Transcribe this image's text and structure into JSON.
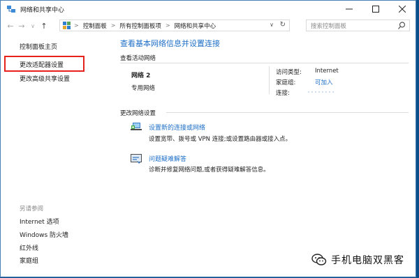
{
  "window": {
    "title": "网络和共享中心",
    "controls": [
      "minimize",
      "maximize",
      "close"
    ]
  },
  "nav": {
    "back_icon": "back-arrow-icon",
    "forward_icon": "forward-arrow-icon",
    "recent_icon": "chevron-down-icon",
    "up_icon": "up-arrow-icon"
  },
  "address": {
    "crumbs": [
      "控制面板",
      "所有控制面板项",
      "网络和共享中心"
    ],
    "separator": ">",
    "dropdown": "∨",
    "refresh": "↻"
  },
  "search": {
    "placeholder": "搜索控制面板"
  },
  "sidebar": {
    "items": [
      {
        "label": "控制面板主页"
      },
      {
        "label": "更改适配器设置",
        "highlighted": true
      },
      {
        "label": "更改高级共享设置"
      }
    ],
    "see_also_label": "另请参阅",
    "see_also_items": [
      {
        "label": "Internet 选项"
      },
      {
        "label": "Windows 防火墙"
      },
      {
        "label": "红外线"
      },
      {
        "label": "家庭组"
      }
    ]
  },
  "main": {
    "heading": "查看基本网络信息并设置连接",
    "active_networks_label": "查看活动网络",
    "network": {
      "name": "网络  2",
      "type": "专用网络",
      "access_type_label": "访问类型:",
      "access_type_value": "Internet",
      "homegroup_label": "家庭组:",
      "homegroup_value": "可加入",
      "connections_label": "连接:"
    },
    "change_settings_label": "更改网络设置",
    "tasks": [
      {
        "title": "设置新的连接或网络",
        "desc": "设置宽带、拨号或 VPN 连接;或设置路由器或接入点。",
        "icon": "new-connection-icon"
      },
      {
        "title": "问题疑难解答",
        "desc": "诊断并修复网络问题,或者获得疑难解答信息。",
        "icon": "troubleshoot-icon"
      }
    ]
  },
  "watermark": {
    "text": "手机电脑双黑客",
    "icon": "wechat-icon"
  },
  "colors": {
    "link": "#1c6ec7",
    "highlight_border": "#e5211a",
    "desktop": "#0b4f8a"
  }
}
